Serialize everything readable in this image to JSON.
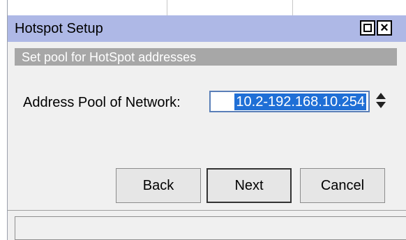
{
  "window": {
    "title": "Hotspot Setup",
    "maximize_icon": "maximize-icon",
    "close_icon": "close-icon",
    "close_glyph": "×"
  },
  "section": {
    "heading": "Set pool for HotSpot addresses"
  },
  "form": {
    "address_pool_label": "Address Pool of Network:",
    "address_pool_value": "10.2-192.168.10.254"
  },
  "buttons": {
    "back": "Back",
    "next": "Next",
    "cancel": "Cancel"
  },
  "colors": {
    "titlebar": "#aeb8e6",
    "subtitle_bar": "#a7a7a7",
    "selection": "#1f6fd6"
  }
}
